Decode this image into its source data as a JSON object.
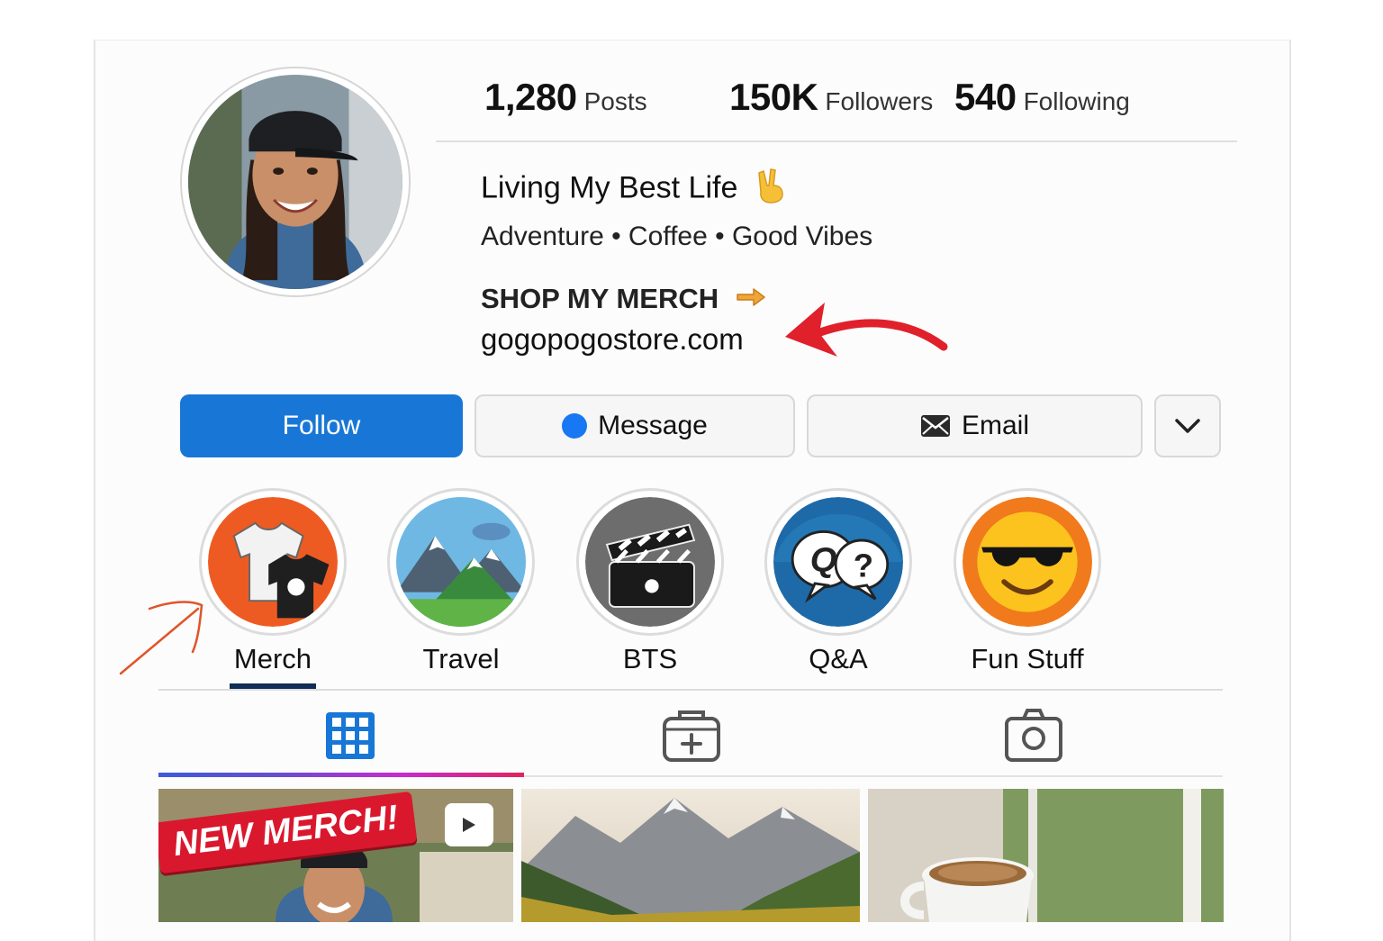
{
  "profile": {
    "stats": [
      {
        "value": "1,280",
        "label": "Posts"
      },
      {
        "value": "150K",
        "label": "Followers"
      },
      {
        "value": "540",
        "label": "Following"
      }
    ],
    "bio": {
      "name_line": "Living My Best Life",
      "tagline": "Adventure • Coffee • Good Vibes",
      "shop_line": "SHOP MY MERCH",
      "link": "gogopogostore.com"
    },
    "avatar_icon": "profile-photo-woman-cap"
  },
  "actions": {
    "follow": "Follow",
    "message": "Message",
    "email": "Email",
    "more_icon": "chevron-down-icon"
  },
  "highlights": [
    {
      "label": "Merch",
      "icon": "tshirt-icon",
      "selected": true
    },
    {
      "label": "Travel",
      "icon": "mountain-icon"
    },
    {
      "label": "BTS",
      "icon": "clapperboard-icon"
    },
    {
      "label": "Q&A",
      "icon": "speech-bubbles-icon"
    },
    {
      "label": "Fun Stuff",
      "icon": "sunglasses-emoji-icon"
    }
  ],
  "tabs": [
    {
      "name": "posts-grid",
      "icon": "grid-icon",
      "active": true
    },
    {
      "name": "add-post",
      "icon": "add-post-icon"
    },
    {
      "name": "tagged",
      "icon": "camera-icon"
    }
  ],
  "grid": [
    {
      "overlay_text": "NEW MERCH!",
      "badge_icon": "play-icon"
    },
    {
      "subject": "mountains"
    },
    {
      "subject": "coffee-cup"
    }
  ],
  "colors": {
    "follow_blue": "#1877d6",
    "annotation_red": "#e0202b",
    "annotation_orange": "#e0552a",
    "merch_banner": "#d9182e"
  }
}
